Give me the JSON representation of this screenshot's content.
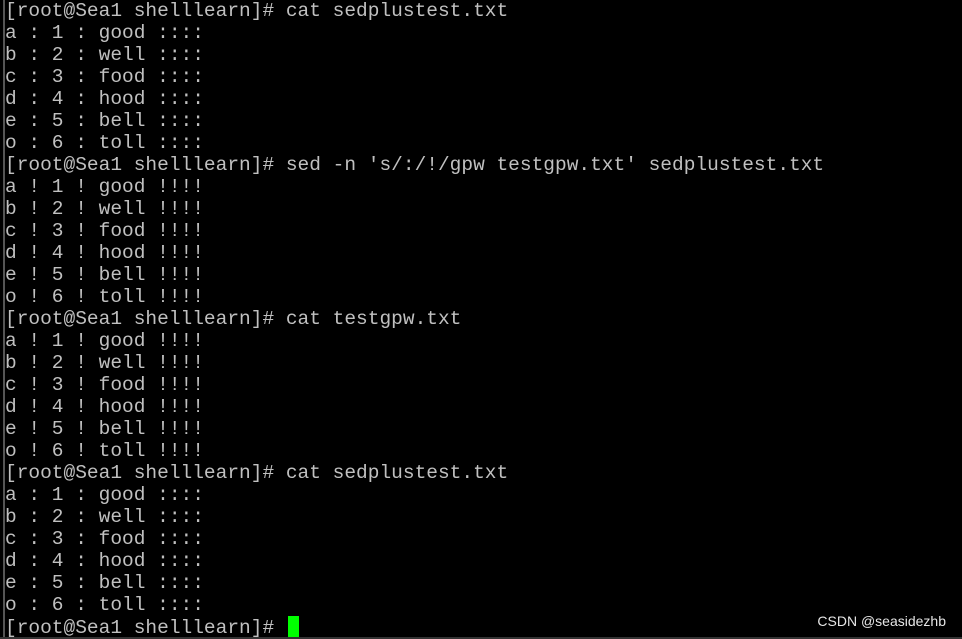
{
  "terminal": {
    "lines": [
      "[root@Sea1 shelllearn]# cat sedplustest.txt",
      "a : 1 : good ::::",
      "b : 2 : well ::::",
      "c : 3 : food ::::",
      "d : 4 : hood ::::",
      "e : 5 : bell ::::",
      "o : 6 : toll ::::",
      "[root@Sea1 shelllearn]# sed -n 's/:/!/gpw testgpw.txt' sedplustest.txt",
      "a ! 1 ! good !!!!",
      "b ! 2 ! well !!!!",
      "c ! 3 ! food !!!!",
      "d ! 4 ! hood !!!!",
      "e ! 5 ! bell !!!!",
      "o ! 6 ! toll !!!!",
      "[root@Sea1 shelllearn]# cat testgpw.txt",
      "a ! 1 ! good !!!!",
      "b ! 2 ! well !!!!",
      "c ! 3 ! food !!!!",
      "d ! 4 ! hood !!!!",
      "e ! 5 ! bell !!!!",
      "o ! 6 ! toll !!!!",
      "[root@Sea1 shelllearn]# cat sedplustest.txt",
      "a : 1 : good ::::",
      "b : 2 : well ::::",
      "c : 3 : food ::::",
      "d : 4 : hood ::::",
      "e : 5 : bell ::::",
      "o : 6 : toll ::::"
    ],
    "prompt": "[root@Sea1 shelllearn]# ",
    "text_color": "#c0c0c0",
    "cursor_color": "#00ff00"
  },
  "watermark": "CSDN @seasidezhb"
}
